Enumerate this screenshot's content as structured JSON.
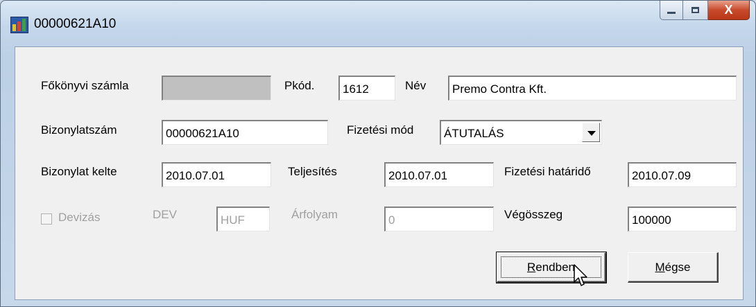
{
  "window": {
    "title": "00000621A10",
    "controls": {
      "minimize": "minimize",
      "maximize": "maximize",
      "close": "X"
    }
  },
  "form": {
    "fokonyvi_szamla": {
      "label": "Főkönyvi számla",
      "value": ""
    },
    "pkod": {
      "label": "Pkód.",
      "value": "1612"
    },
    "nev": {
      "label": "Név",
      "value": "Premo Contra Kft."
    },
    "bizonylatszam": {
      "label": "Bizonylatszám",
      "value": "00000621A10"
    },
    "fizetesi_mod": {
      "label": "Fizetési mód",
      "value": "ÁTUTALÁS"
    },
    "bizonylat_kelte": {
      "label": "Bizonylat kelte",
      "value": "2010.07.01"
    },
    "teljesites": {
      "label": "Teljesítés",
      "value": "2010.07.01"
    },
    "fizetesi_hatarido": {
      "label": "Fizetési határidő",
      "value": "2010.07.09"
    },
    "devizas": {
      "label": "Devizás",
      "checked": false
    },
    "dev": {
      "label": "DEV",
      "value": "HUF"
    },
    "arfolyam": {
      "label": "Árfolyam",
      "value": "0"
    },
    "vegosszeg": {
      "label": "Végösszeg",
      "value": "100000"
    }
  },
  "buttons": {
    "ok": {
      "accel": "R",
      "rest": "endben"
    },
    "cancel": {
      "accel": "M",
      "rest": "égse"
    }
  }
}
